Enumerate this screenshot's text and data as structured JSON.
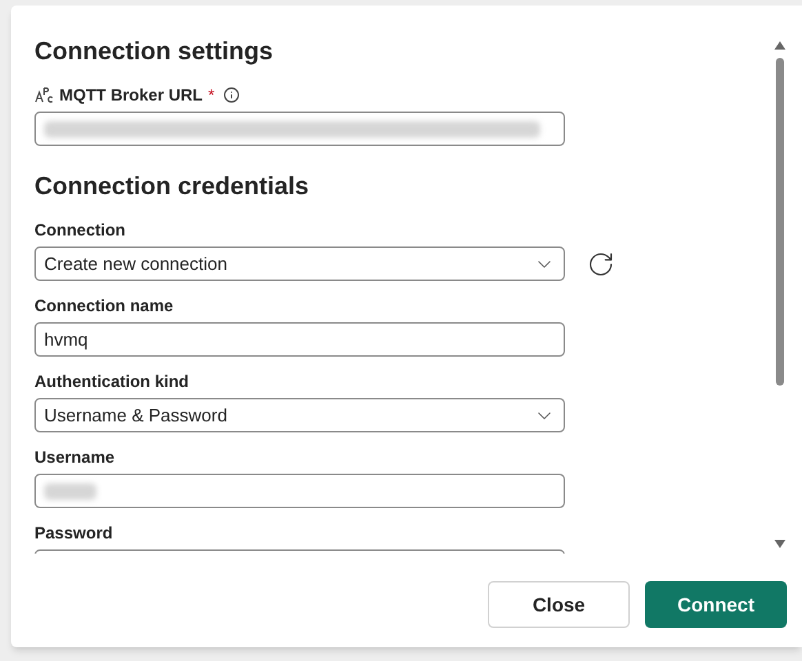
{
  "sections": [
    {
      "heading": "Connection settings",
      "fields": [
        {
          "kind": "text",
          "label": "MQTT Broker URL",
          "required": true,
          "info": true,
          "type_icon": true,
          "redacted": true
        }
      ]
    },
    {
      "heading": "Connection credentials",
      "fields": [
        {
          "kind": "dropdown",
          "label": "Connection",
          "value": "Create new connection",
          "refresh": true
        },
        {
          "kind": "text",
          "label": "Connection name",
          "value": "hvmq"
        },
        {
          "kind": "dropdown",
          "label": "Authentication kind",
          "value": "Username & Password"
        },
        {
          "kind": "text",
          "label": "Username",
          "redacted": true
        },
        {
          "kind": "text",
          "label": "Password"
        }
      ]
    }
  ],
  "required_mark": "*",
  "buttons": [
    {
      "label": "Close",
      "kind": "secondary"
    },
    {
      "label": "Connect",
      "kind": "primary"
    }
  ]
}
